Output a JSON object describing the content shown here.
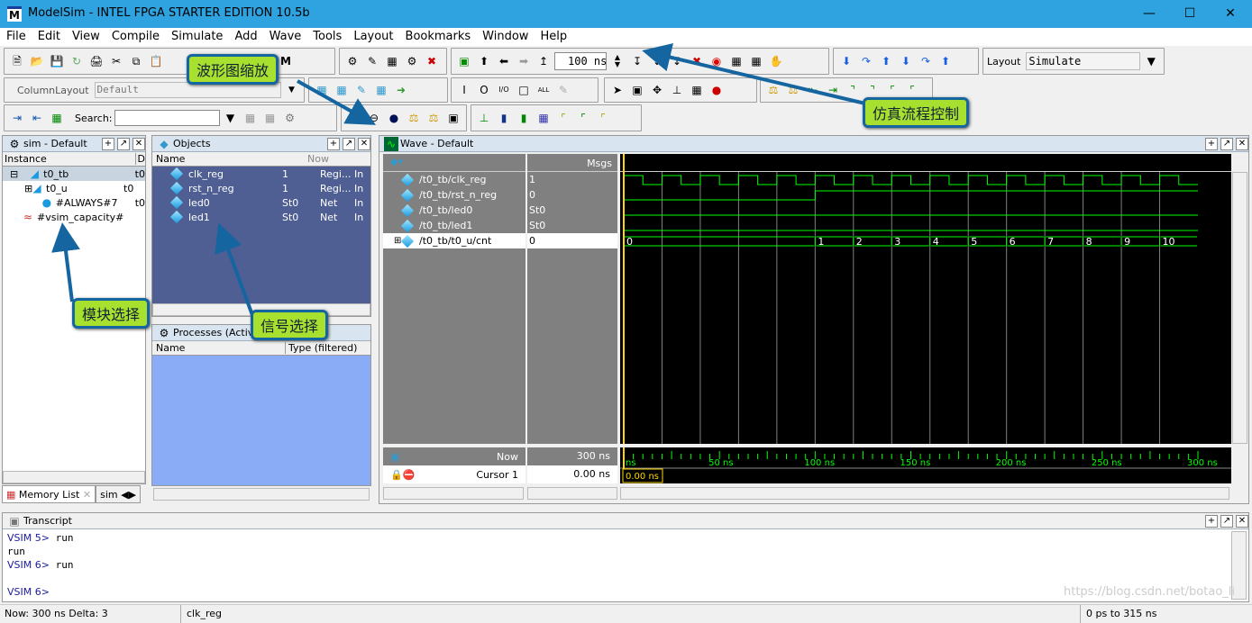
{
  "window": {
    "title": "ModelSim - INTEL FPGA STARTER EDITION 10.5b",
    "logo": "M"
  },
  "menu": [
    "File",
    "Edit",
    "View",
    "Compile",
    "Simulate",
    "Add",
    "Wave",
    "Tools",
    "Layout",
    "Bookmarks",
    "Window",
    "Help"
  ],
  "toolbar": {
    "run_length": "100 ns",
    "column_layout_label": "ColumnLayout",
    "column_layout_value": "Default",
    "search_label": "Search:",
    "search_value": "",
    "layout_label": "Layout",
    "layout_value": "Simulate"
  },
  "sim_panel": {
    "title": "sim - Default",
    "col_instance": "Instance",
    "col_design": "D",
    "items": [
      {
        "name": "t0_tb",
        "design": "t0"
      },
      {
        "name": "t0_u",
        "design": "t0"
      },
      {
        "name": "#ALWAYS#7",
        "design": "t0"
      },
      {
        "name": "#vsim_capacity#",
        "design": ""
      }
    ]
  },
  "objects_panel": {
    "title": "Objects",
    "col_name": "Name",
    "col_now": "Now",
    "items": [
      {
        "name": "clk_reg",
        "value": "1",
        "kind": "Regi...",
        "mode": "In"
      },
      {
        "name": "rst_n_reg",
        "value": "1",
        "kind": "Regi...",
        "mode": "In"
      },
      {
        "name": "led0",
        "value": "St0",
        "kind": "Net",
        "mode": "In"
      },
      {
        "name": "led1",
        "value": "St0",
        "kind": "Net",
        "mode": "In"
      }
    ]
  },
  "processes_panel": {
    "title": "Processes (Active)",
    "col_name": "Name",
    "col_type": "Type (filtered)"
  },
  "bottom_tabs": [
    "Memory List",
    "sim"
  ],
  "wave": {
    "title": "Wave - Default",
    "msgs_label": "Msgs",
    "signals": [
      {
        "name": "/t0_tb/clk_reg",
        "value": "1"
      },
      {
        "name": "/t0_tb/rst_n_reg",
        "value": "0"
      },
      {
        "name": "/t0_tb/led0",
        "value": "St0"
      },
      {
        "name": "/t0_tb/led1",
        "value": "St0"
      },
      {
        "name": "/t0_tb/t0_u/cnt",
        "value": "0"
      }
    ],
    "now_label": "Now",
    "now_value": "300 ns",
    "cursor_label": "Cursor 1",
    "cursor_value": "0.00 ns",
    "cursor_marker": "0.00 ns",
    "time_ticks": [
      "ns",
      "50 ns",
      "100 ns",
      "150 ns",
      "200 ns",
      "250 ns",
      "300 ns"
    ],
    "time_range_ns": [
      0,
      300
    ],
    "clk": {
      "period_ns": 20,
      "high_first_ns": 10
    },
    "rst_rise_ns": 100,
    "cnt": [
      {
        "from": 0,
        "to": 100,
        "v": "0"
      },
      {
        "from": 100,
        "to": 120,
        "v": "1"
      },
      {
        "from": 120,
        "to": 140,
        "v": "2"
      },
      {
        "from": 140,
        "to": 160,
        "v": "3"
      },
      {
        "from": 160,
        "to": 180,
        "v": "4"
      },
      {
        "from": 180,
        "to": 200,
        "v": "5"
      },
      {
        "from": 200,
        "to": 220,
        "v": "6"
      },
      {
        "from": 220,
        "to": 240,
        "v": "7"
      },
      {
        "from": 240,
        "to": 260,
        "v": "8"
      },
      {
        "from": 260,
        "to": 280,
        "v": "9"
      },
      {
        "from": 280,
        "to": 300,
        "v": "10"
      }
    ],
    "colors": {
      "signal": "#00ff00",
      "grid": "#808080",
      "cursor": "#ffd700",
      "time": "#00ff00"
    }
  },
  "transcript": {
    "title": "Transcript",
    "lines": [
      {
        "prompt": "VSIM 5>",
        "cmd": " run"
      },
      {
        "prompt": "",
        "cmd": "run"
      },
      {
        "prompt": "VSIM 6>",
        "cmd": " run"
      },
      {
        "prompt": "",
        "cmd": ""
      },
      {
        "prompt": "VSIM 6>",
        "cmd": ""
      }
    ]
  },
  "status": {
    "now": "Now: 300 ns  Delta: 3",
    "signal": "clk_reg",
    "range": "0 ps to 315 ns"
  },
  "annotations": {
    "zoom": "波形图缩放",
    "sim_control": "仿真流程控制",
    "module_select": "模块选择",
    "signal_select": "信号选择"
  },
  "watermark": "https://blog.csdn.net/botao_li"
}
